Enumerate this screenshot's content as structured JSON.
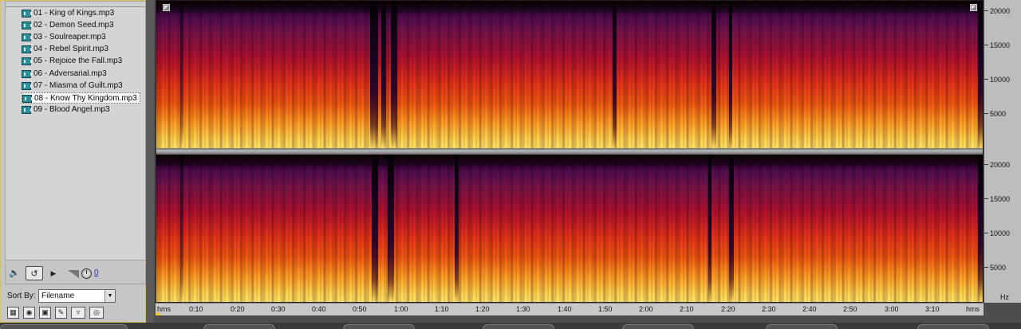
{
  "file_panel": {
    "files": [
      {
        "label": "01 - King of Kings.mp3",
        "selected": false
      },
      {
        "label": "02 - Demon Seed.mp3",
        "selected": false
      },
      {
        "label": "03 - Soulreaper.mp3",
        "selected": false
      },
      {
        "label": "04 - Rebel Spirit.mp3",
        "selected": false
      },
      {
        "label": "05 - Rejoice the Fall.mp3",
        "selected": false
      },
      {
        "label": "06 - Adversarial.mp3",
        "selected": false
      },
      {
        "label": "07 - Miasma of Guilt.mp3",
        "selected": false
      },
      {
        "label": "08 - Know Thy Kingdom.mp3",
        "selected": true
      },
      {
        "label": "09 - Blood Angel.mp3",
        "selected": false
      }
    ],
    "transport": {
      "speaker_icon": "speaker-icon",
      "loop_icon": "loop-icon",
      "play_icon": "play-icon",
      "volume_value": "0"
    },
    "sort": {
      "label": "Sort By:",
      "selected": "Filename"
    }
  },
  "spectral_view": {
    "frequency_labels": [
      "20000",
      "15000",
      "10000",
      "5000",
      "Hz"
    ],
    "time_unit": "hms",
    "time_labels": [
      "0:10",
      "0:20",
      "0:30",
      "0:40",
      "0:50",
      "1:00",
      "1:10",
      "1:20",
      "1:30",
      "1:40",
      "1:50",
      "2:00",
      "2:10",
      "2:20",
      "2:30",
      "2:40",
      "2:50",
      "3:00",
      "3:10"
    ],
    "colors": {
      "accent_border": "#e2c24a",
      "playhead": "#f2c419"
    }
  }
}
